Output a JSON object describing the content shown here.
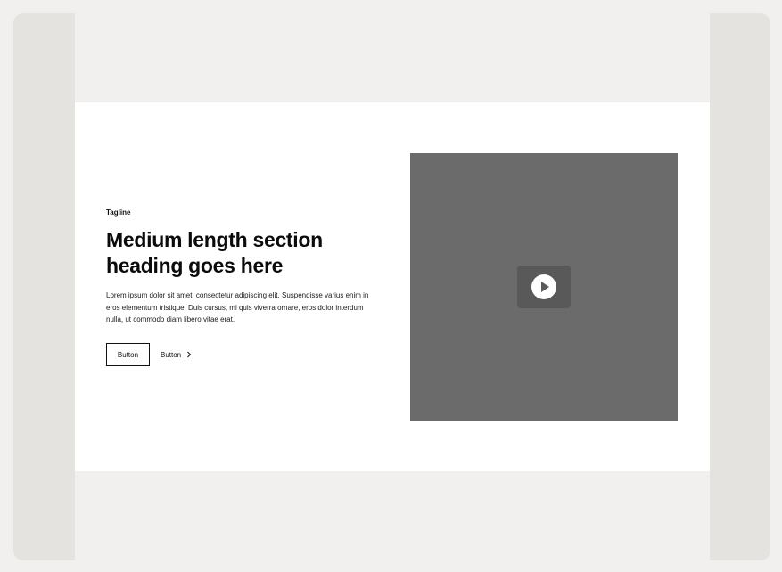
{
  "colors": {
    "page_background": "#f1f0ee",
    "frame_background": "#e4e3e0",
    "section_background": "#ffffff",
    "media_placeholder": "#6b6b6b",
    "play_button": "#595959",
    "text": "#111111"
  },
  "section": {
    "tagline": "Tagline",
    "heading": "Medium length section heading goes here",
    "body": "Lorem ipsum dolor sit amet, consectetur adipiscing elit. Suspendisse varius enim in eros elementum tristique. Duis cursus, mi quis viverra ornare, eros dolor interdum nulla, ut commodo diam libero vitae erat.",
    "primary_button_label": "Button",
    "secondary_button_label": "Button",
    "secondary_button_icon": "chevron-right-icon"
  },
  "media": {
    "play_icon": "play-icon"
  }
}
